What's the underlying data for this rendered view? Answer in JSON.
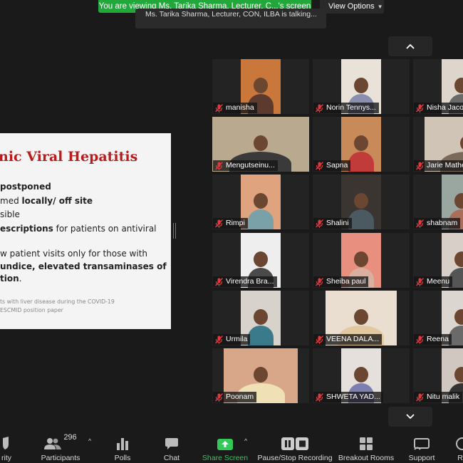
{
  "banner": {
    "viewing_text": "You are viewing Ms. Tarika Sharma, Lecturer, C...'s screen",
    "view_options": "View Options",
    "talking_text": "Ms. Tarika Sharma, Lecturer, CON, ILBA is talking..."
  },
  "slide": {
    "title": "nic Viral Hepatitis",
    "lines": [
      {
        "pre": "",
        "bold": "postponed",
        "post": ""
      },
      {
        "pre": "med ",
        "bold": "locally/ off site",
        "post": ""
      },
      {
        "pre": "sible",
        "bold": "",
        "post": ""
      },
      {
        "pre": "",
        "bold": "escriptions",
        "post": " for patients on antiviral"
      },
      {
        "pre": "w patient visits only for those with",
        "bold": "",
        "post": ""
      },
      {
        "pre": "",
        "bold": "undice, elevated transaminases of",
        "post": ""
      },
      {
        "pre": "",
        "bold": "tion",
        "post": "."
      }
    ],
    "footnote_1": "ts with liver disease during the COVID-19",
    "footnote_2": "ESCMID position paper"
  },
  "gallery": {
    "participants": [
      "manisha",
      "Norin Tennys...",
      "Nisha Jaco",
      "Mengutseinu...",
      "Sapna",
      "Jarie Mathe",
      "Rimpi",
      "Shalini",
      "shabnam",
      "Virendra Bra...",
      "Sheiba paul",
      "Meenu",
      "Urmila",
      "VEENA DALA...",
      "Reena",
      "Poonam",
      "SHWETA YAD...",
      "Nitu malik"
    ]
  },
  "toolbar": {
    "security": "rity",
    "participants": "Participants",
    "participants_count": "296",
    "polls": "Polls",
    "chat": "Chat",
    "share_screen": "Share Screen",
    "record": "Pause/Stop Recording",
    "breakout": "Breakout Rooms",
    "support": "Support",
    "reactions": "Re"
  },
  "colors": {
    "banner_green": "#22a83a",
    "share_green": "#34c759",
    "slide_title_red": "#b91c1c",
    "muted_red": "#e0393e"
  }
}
